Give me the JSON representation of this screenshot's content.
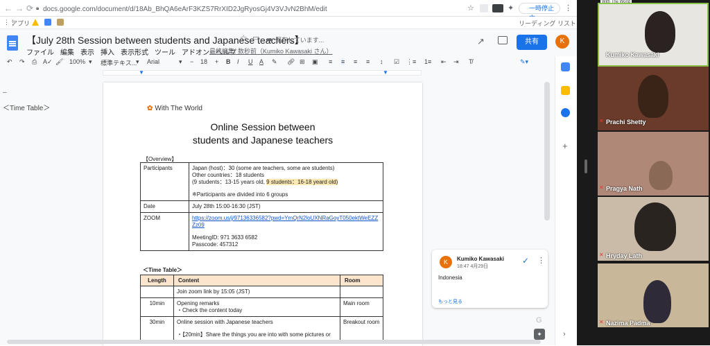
{
  "browser": {
    "url": "docs.google.com/document/d/18Ab_BhQA6eArF3KZS7RrXID2JgRyosGj4V3VJvN2BhM/edit",
    "paused_label": "一時停止中",
    "bookmarks_apps": "アプリ",
    "reading_list": "リーディング リスト"
  },
  "doc": {
    "title": "【July 28th Session between students and Japanese teachers】",
    "saving_status": "保存しています...",
    "menu": [
      "ファイル",
      "編集",
      "表示",
      "挿入",
      "表示形式",
      "ツール",
      "アドオン",
      "ヘルプ"
    ],
    "last_edit": "最終編集: 数秒前（Kumiko Kawasaki さん）",
    "share_label": "共有",
    "avatar_initial": "K",
    "toolbar": {
      "zoom": "100%",
      "style": "標準テキス...",
      "font": "Arial",
      "size": "18"
    },
    "ruler_ticks": [
      "2",
      "1",
      "1",
      "2",
      "3",
      "4",
      "5",
      "6",
      "7",
      "8",
      "9",
      "10",
      "11",
      "12",
      "13",
      "14",
      "15",
      "16",
      "17",
      "18"
    ]
  },
  "outline": {
    "dash": "–",
    "item": "＜Time Table＞"
  },
  "page": {
    "logo_text": "With The World",
    "heading_line1": "Online Session between",
    "heading_line2": "students and Japanese teachers",
    "overview_label": "【Overview】",
    "table1": {
      "participants_label": "Participants",
      "participants_lines": [
        "Japan (host)：30 (some are teachers, some are students)",
        "Other countries：18 students",
        "(9 students：13-15 years old, ",
        "9 students：16-18 yeard old)",
        "※Participants are divided into 6 groups"
      ],
      "date_label": "Date",
      "date_value": "July 28th 15:00-16:30 (JST)",
      "zoom_label": "ZOOM",
      "zoom_link": "https://zoom.us/j/97136336582?pwd=YmQrN2loUXNRaGoyT050ektWeEZZZz09",
      "meeting_id": "MeetingID: 971 3633 6582",
      "passcode": "Passcode: 457312"
    },
    "timetable_label": "＜Time Table＞",
    "table2": {
      "headers": [
        "Length",
        "Content",
        "Room"
      ],
      "rows": [
        {
          "length": "",
          "content": [
            "Join zoom link by 15:05 (JST)"
          ],
          "room": ""
        },
        {
          "length": "10min",
          "content": [
            "Opening remarks",
            "・Check the content today"
          ],
          "room": "Main room"
        },
        {
          "length": "30min",
          "content": [
            "Online session with Japanese teachers",
            "",
            "・【20min】Share the things you are into with some pictures or"
          ],
          "room": "Breakout room"
        }
      ]
    }
  },
  "comment": {
    "initial": "K",
    "author": "Kumiko Kawasaki",
    "time": "18:47 4月29日",
    "text": "Indonesia",
    "more_link": "もっと見る"
  },
  "zoom": {
    "brand": "With The World",
    "participants": [
      {
        "name": "Kumiko Kawasaki",
        "bg": "#e8e6e0"
      },
      {
        "name": "Prachi Shetty",
        "bg": "#6a3b2a"
      },
      {
        "name": "Pragya Nath",
        "bg": "#b08878"
      },
      {
        "name": "Hryday Lath",
        "bg": "#c9bba8"
      },
      {
        "name": "Nazima Padma",
        "bg": "#c9b79a"
      }
    ]
  }
}
